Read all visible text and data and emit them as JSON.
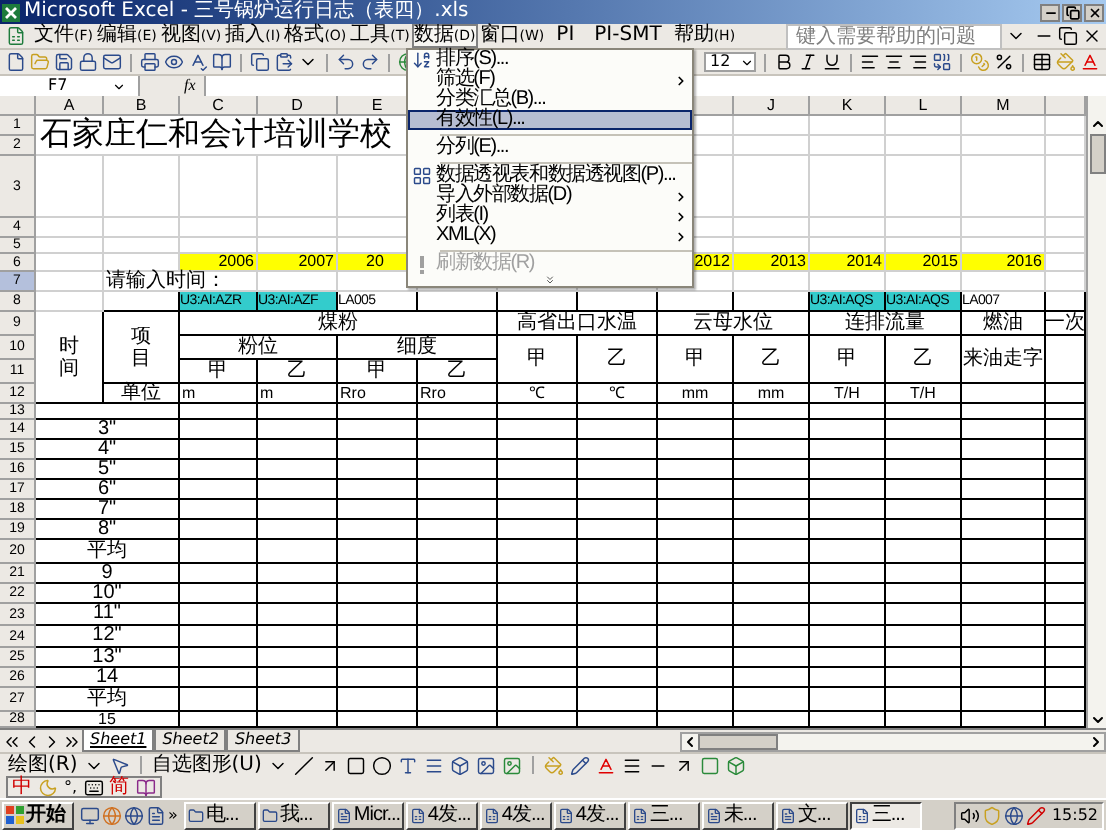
{
  "window": {
    "title": "Microsoft Excel - 三号锅炉运行日志（表四）.xls"
  },
  "menu_bar": [
    {
      "label": "文件",
      "accelerator": "(F)",
      "selected": false
    },
    {
      "label": "编辑",
      "accelerator": "(E)",
      "selected": false
    },
    {
      "label": "视图",
      "accelerator": "(V)",
      "selected": false
    },
    {
      "label": "插入",
      "accelerator": "(I)",
      "selected": false
    },
    {
      "label": "格式",
      "accelerator": "(O)",
      "selected": false
    },
    {
      "label": "工具",
      "accelerator": "(T)",
      "selected": false
    },
    {
      "label": "数据",
      "accelerator": "(D)",
      "selected": true
    },
    {
      "label": "窗口",
      "accelerator": "(W)",
      "selected": false
    },
    {
      "label": "PI",
      "selected": false
    },
    {
      "label": "PI-SMT",
      "selected": false
    },
    {
      "label": "帮助",
      "accelerator": "(H)",
      "selected": false
    }
  ],
  "help_box": {
    "placeholder": "键入需要帮助的问题"
  },
  "data_menu": [
    {
      "kind": "item",
      "label": "排序(S)...",
      "submenu": false,
      "selected": false,
      "disabled": false
    },
    {
      "kind": "item",
      "label": "筛选(F)",
      "submenu": true,
      "selected": false,
      "disabled": false
    },
    {
      "kind": "item",
      "label": "分类汇总(B)...",
      "submenu": false,
      "selected": false,
      "disabled": false
    },
    {
      "kind": "item",
      "label": "有效性(L)...",
      "submenu": false,
      "selected": true,
      "disabled": false
    },
    {
      "kind": "separator"
    },
    {
      "kind": "item",
      "label": "分列(E)...",
      "submenu": false,
      "selected": false,
      "disabled": false
    },
    {
      "kind": "separator"
    },
    {
      "kind": "item",
      "label": "数据透视表和数据透视图(P)...",
      "submenu": false,
      "selected": false,
      "disabled": false
    },
    {
      "kind": "item",
      "label": "导入外部数据(D)",
      "submenu": true,
      "selected": false,
      "disabled": false
    },
    {
      "kind": "item",
      "label": "列表(I)",
      "submenu": true,
      "selected": false,
      "disabled": false
    },
    {
      "kind": "item",
      "label": "XML(X)",
      "submenu": true,
      "selected": false,
      "disabled": false
    },
    {
      "kind": "separator"
    },
    {
      "kind": "item",
      "label": "刷新数据(R)",
      "submenu": false,
      "selected": false,
      "disabled": true
    },
    {
      "kind": "more"
    }
  ],
  "toolbar": {
    "font_size": "12"
  },
  "formula_bar": {
    "name_box": "F7",
    "function_label": "fx"
  },
  "sheet": {
    "column_headers": [
      "A",
      "B",
      "C",
      "D",
      "E",
      "J",
      "K",
      "L",
      "M"
    ],
    "rows": [
      {
        "number": "1",
        "selected": false,
        "cells": [
          {
            "text": "石家庄仁和会计培训学校"
          }
        ]
      },
      {
        "number": "2",
        "selected": false
      },
      {
        "number": "3",
        "selected": false
      },
      {
        "number": "4",
        "selected": false
      },
      {
        "number": "5",
        "selected": false
      },
      {
        "number": "6",
        "selected": false,
        "cells": [
          {
            "text": "2006",
            "color": "#ffff00"
          },
          {
            "text": "2007",
            "color": "#ffff00"
          },
          {
            "text": "20",
            "color": "#ffff00"
          },
          {
            "text": "2012",
            "color": "#ffff00"
          },
          {
            "text": "2013",
            "color": "#ffff00"
          },
          {
            "text": "2014",
            "color": "#ffff00"
          },
          {
            "text": "2015",
            "color": "#ffff00"
          },
          {
            "text": "2016",
            "color": "#ffff00"
          }
        ]
      },
      {
        "number": "7",
        "selected": true,
        "cells": [
          {
            "text": "请输入时间："
          }
        ]
      },
      {
        "number": "8",
        "selected": false,
        "cells": [
          {
            "text": "U3:AI:AZR",
            "color": "#33cccc"
          },
          {
            "text": "U3:AI:AZF",
            "color": "#33cccc"
          },
          {
            "text": "LA005"
          },
          {
            "text": "U3:AI:AQS",
            "color": "#33cccc"
          },
          {
            "text": "U3:AI:AQS",
            "color": "#33cccc"
          },
          {
            "text": "LA007"
          }
        ]
      },
      {
        "number": "9",
        "selected": false,
        "cells": [
          {
            "text": "时间"
          },
          {
            "text": "项目"
          },
          {
            "text": "煤粉"
          },
          {
            "text": "高省出口水温"
          },
          {
            "text": "云母水位"
          },
          {
            "text": "连排流量"
          },
          {
            "text": "燃油"
          },
          {
            "text": "一次"
          }
        ]
      },
      {
        "number": "10",
        "selected": false,
        "cells": [
          {
            "text": "粉位"
          },
          {
            "text": "细度"
          },
          {
            "text": "甲"
          },
          {
            "text": "乙"
          },
          {
            "text": "甲"
          },
          {
            "text": "乙"
          },
          {
            "text": "甲"
          },
          {
            "text": "乙"
          },
          {
            "text": "来油走字"
          }
        ]
      },
      {
        "number": "11",
        "selected": false,
        "cells": [
          {
            "text": "甲"
          },
          {
            "text": "乙"
          },
          {
            "text": "甲"
          },
          {
            "text": "乙"
          }
        ]
      },
      {
        "number": "12",
        "selected": false,
        "cells": [
          {
            "text": "单位"
          },
          {
            "text": "m"
          },
          {
            "text": "m"
          },
          {
            "text": "Rro"
          },
          {
            "text": "Rro"
          },
          {
            "text": "℃"
          },
          {
            "text": "℃"
          },
          {
            "text": "mm"
          },
          {
            "text": "mm"
          },
          {
            "text": "T/H"
          },
          {
            "text": "T/H"
          }
        ]
      },
      {
        "number": "13",
        "selected": false
      },
      {
        "number": "14",
        "selected": false,
        "cells": [
          {
            "text": "3\""
          }
        ]
      },
      {
        "number": "15",
        "selected": false,
        "cells": [
          {
            "text": "4\""
          }
        ]
      },
      {
        "number": "16",
        "selected": false,
        "cells": [
          {
            "text": "5\""
          }
        ]
      },
      {
        "number": "17",
        "selected": false,
        "cells": [
          {
            "text": "6\""
          }
        ]
      },
      {
        "number": "18",
        "selected": false,
        "cells": [
          {
            "text": "7\""
          }
        ]
      },
      {
        "number": "19",
        "selected": false,
        "cells": [
          {
            "text": "8\""
          }
        ]
      },
      {
        "number": "20",
        "selected": false,
        "cells": [
          {
            "text": "平均"
          }
        ]
      },
      {
        "number": "21",
        "selected": false,
        "cells": [
          {
            "text": "9"
          }
        ]
      },
      {
        "number": "22",
        "selected": false,
        "cells": [
          {
            "text": "10\""
          }
        ]
      },
      {
        "number": "23",
        "selected": false,
        "cells": [
          {
            "text": "11\""
          }
        ]
      },
      {
        "number": "24",
        "selected": false,
        "cells": [
          {
            "text": "12\""
          }
        ]
      },
      {
        "number": "25",
        "selected": false,
        "cells": [
          {
            "text": "13\""
          }
        ]
      },
      {
        "number": "26",
        "selected": false,
        "cells": [
          {
            "text": "14"
          }
        ]
      },
      {
        "number": "27",
        "selected": false,
        "cells": [
          {
            "text": "平均"
          }
        ]
      },
      {
        "number": "28",
        "selected": false,
        "cells": [
          {
            "text": "15"
          }
        ]
      }
    ]
  },
  "sheet_tabs": [
    {
      "label": "Sheet1",
      "selected": true
    },
    {
      "label": "Sheet2",
      "selected": false
    },
    {
      "label": "Sheet3",
      "selected": false
    }
  ],
  "drawing_toolbar": {
    "draw_menu": "绘图(R)",
    "autoshapes_menu": "自选图形(U)"
  },
  "ime_bar": {
    "mode": "中",
    "punctuation": "°,",
    "charset": "简"
  },
  "taskbar": {
    "start": "开始",
    "quick_launch_more": "»",
    "clock": "15:52",
    "tasks": [
      {
        "label": "电...",
        "selected": false
      },
      {
        "label": "我...",
        "selected": false
      },
      {
        "label": "Micr...",
        "selected": false
      },
      {
        "label": "4发...",
        "selected": false
      },
      {
        "label": "4发...",
        "selected": false
      },
      {
        "label": "4发...",
        "selected": false
      },
      {
        "label": "三...",
        "selected": false
      },
      {
        "label": "未...",
        "selected": false
      },
      {
        "label": "文...",
        "selected": false
      },
      {
        "label": "三...",
        "selected": true
      }
    ]
  }
}
